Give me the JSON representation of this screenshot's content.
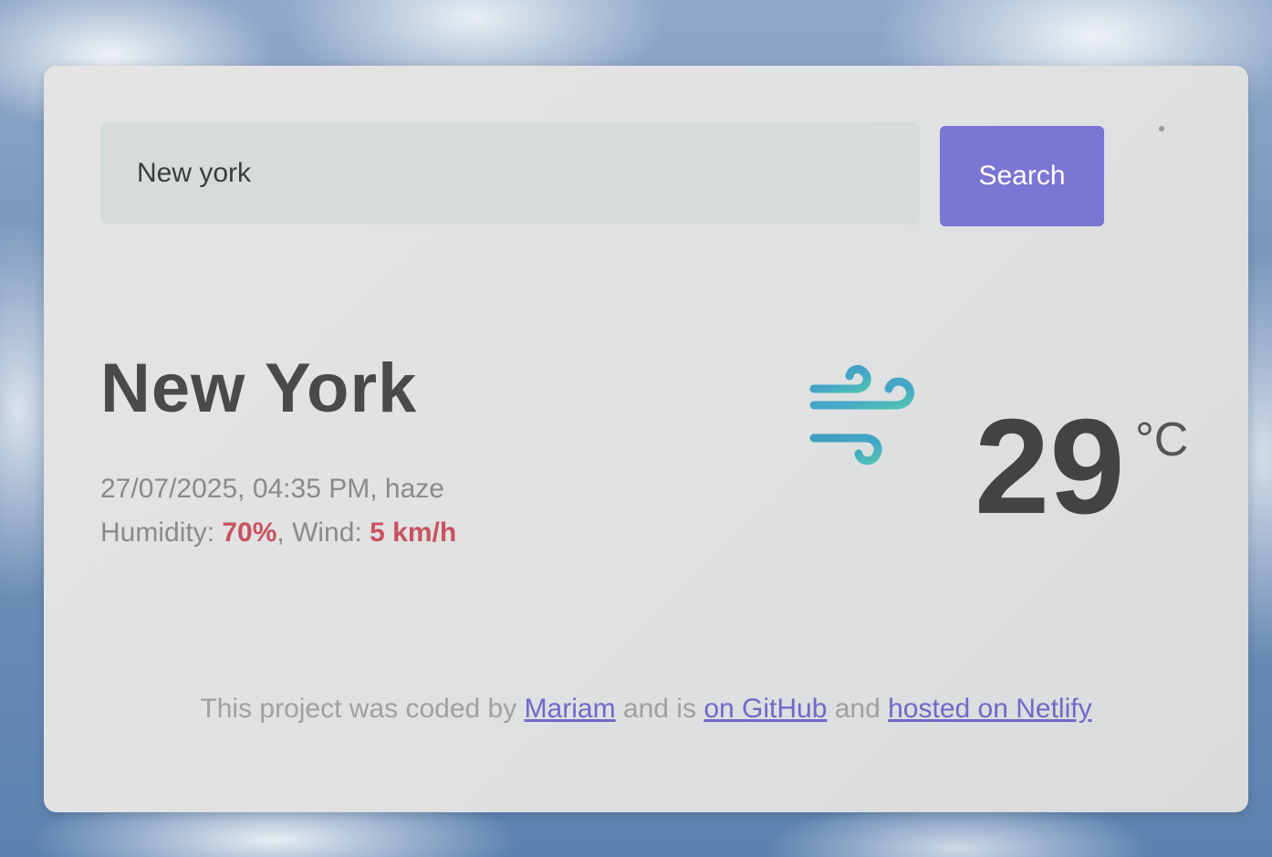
{
  "search": {
    "value": "New york",
    "button_label": "Search"
  },
  "current": {
    "city": "New York",
    "datetime_description": "27/07/2025, 04:35 PM, haze",
    "humidity_label": "Humidity: ",
    "humidity_value": "70%",
    "separator": ", ",
    "wind_label": "Wind: ",
    "wind_value": "5 km/h",
    "temperature": "29",
    "unit": "°C",
    "icon": "wind-icon"
  },
  "footer": {
    "text_1": "This project was coded by ",
    "author_link": "Mariam",
    "text_2": " and is ",
    "github_link": "on GitHub",
    "text_3": " and ",
    "netlify_link": "hosted on Netlify"
  },
  "colors": {
    "accent": "#7b75d4",
    "highlight": "#c9525f",
    "link": "#6f69c8"
  }
}
